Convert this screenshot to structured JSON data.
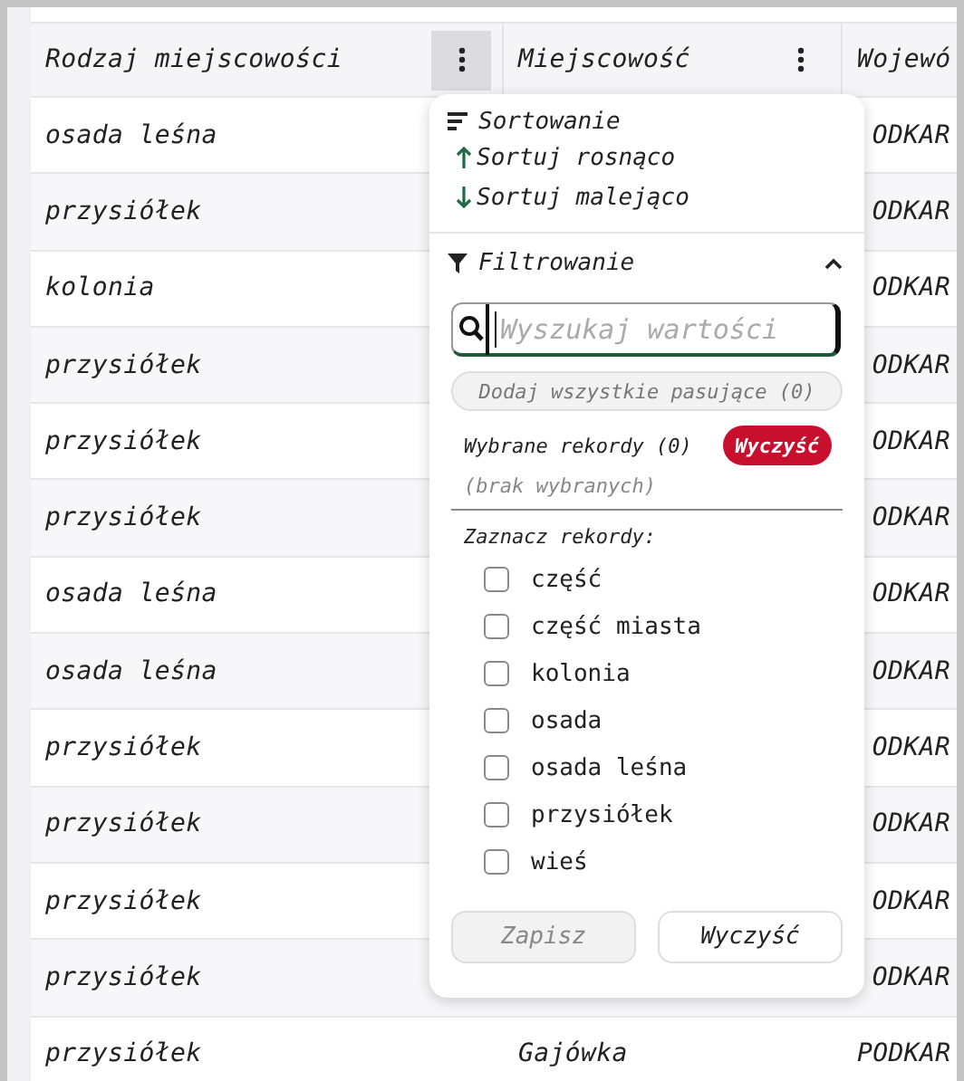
{
  "table": {
    "columns": [
      {
        "label": "Rodzaj miejscowości",
        "menu_open": true
      },
      {
        "label": "Miejscowość",
        "menu_open": false
      },
      {
        "label": "Wojewó"
      }
    ],
    "rows": [
      [
        "osada leśna",
        null,
        "ODKAR"
      ],
      [
        "przysiółek",
        null,
        "ODKAR"
      ],
      [
        "kolonia",
        null,
        "ODKAR"
      ],
      [
        "przysiółek",
        null,
        "ODKAR"
      ],
      [
        "przysiółek",
        null,
        "ODKAR"
      ],
      [
        "przysiółek",
        null,
        "ODKAR"
      ],
      [
        "osada leśna",
        null,
        "ODKAR"
      ],
      [
        "osada leśna",
        null,
        "ODKAR"
      ],
      [
        "przysiółek",
        null,
        "ODKAR"
      ],
      [
        "przysiółek",
        null,
        "ODKAR"
      ],
      [
        "przysiółek",
        null,
        "ODKAR"
      ],
      [
        "przysiółek",
        null,
        "ODKAR"
      ],
      [
        "przysiółek",
        "Gajówka",
        "PODKAR"
      ]
    ]
  },
  "column_menu": {
    "sorting": {
      "title": "Sortowanie",
      "items": [
        {
          "kind": "asc",
          "label": "Sortuj rosnąco"
        },
        {
          "kind": "desc",
          "label": "Sortuj malejąco"
        }
      ]
    },
    "filtering": {
      "title": "Filtrowanie",
      "expanded": true,
      "search": {
        "placeholder": "Wyszukaj wartości"
      },
      "add_all": {
        "label": "Dodaj wszystkie pasujące (0)",
        "disabled": true
      },
      "selected_label": "Wybrane rekordy (0)",
      "clear_selected": "Wyczyść",
      "none_selected": "(brak wybranych)",
      "pick_label": "Zaznacz rekordy:",
      "options": [
        {
          "label": "część",
          "checked": false
        },
        {
          "label": "część miasta",
          "checked": false
        },
        {
          "label": "kolonia",
          "checked": false
        },
        {
          "label": "osada",
          "checked": false
        },
        {
          "label": "osada leśna",
          "checked": false
        },
        {
          "label": "przysiółek",
          "checked": false
        },
        {
          "label": "wieś",
          "checked": false
        }
      ]
    },
    "buttons": [
      {
        "label": "Zapisz",
        "disabled": true
      },
      {
        "label": "Wyczyść",
        "disabled": false
      }
    ]
  }
}
